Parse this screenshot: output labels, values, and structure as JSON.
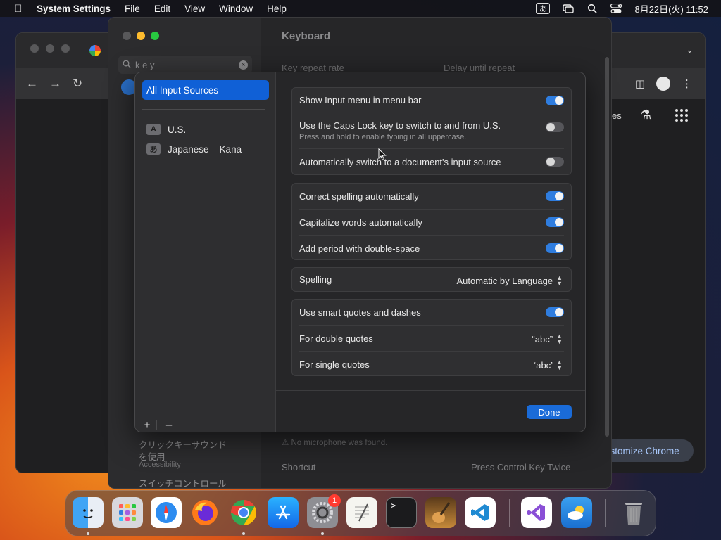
{
  "menubar": {
    "app_name": "System Settings",
    "menus": [
      "File",
      "Edit",
      "View",
      "Window",
      "Help"
    ],
    "ime_indicator": "あ",
    "clock": "8月22日(火) 11:52"
  },
  "chrome": {
    "ntp_partial_text": "es",
    "customize_label": "ustomize Chrome"
  },
  "settings": {
    "title": "Keyboard",
    "search_value": "k e y",
    "sidebar_jp_1": "クリックキーサウンド",
    "sidebar_jp_2": "を使用",
    "sidebar_jp_3": "Accessibility",
    "sidebar_jp_4": "スイッチコントロール",
    "bg_key_repeat": "Key repeat rate",
    "bg_delay": "Delay until repeat",
    "bg_warning": "⚠ No microphone was found.",
    "bg_shortcut_label": "Shortcut",
    "bg_shortcut_value": "Press Control Key Twice"
  },
  "input_sources": {
    "all_label": "All Input Sources",
    "sources": [
      {
        "badge": "A",
        "name": "U.S."
      },
      {
        "badge": "あ",
        "name": "Japanese – Kana"
      }
    ],
    "add_label": "+",
    "remove_label": "–",
    "group1": {
      "show_menu": "Show Input menu in menu bar",
      "caps_lock": "Use the Caps Lock key to switch to and from U.S.",
      "caps_lock_sub": "Press and hold to enable typing in all uppercase.",
      "auto_switch": "Automatically switch to a document's input source"
    },
    "group2": {
      "correct_spelling": "Correct spelling automatically",
      "capitalize": "Capitalize words automatically",
      "period": "Add period with double-space"
    },
    "spelling_label": "Spelling",
    "spelling_value": "Automatic by Language",
    "group4": {
      "smart_quotes": "Use smart quotes and dashes",
      "double_quotes": "For double quotes",
      "double_quotes_value": "“abc”",
      "single_quotes": "For single quotes",
      "single_quotes_value": "‘abc’"
    },
    "done_label": "Done"
  },
  "dock": {
    "settings_badge": "1",
    "terminal_glyph": ">_"
  },
  "colors": {
    "accent": "#1060d6",
    "toggle_on": "#2f7ddf",
    "toggle_off": "#56565a"
  }
}
